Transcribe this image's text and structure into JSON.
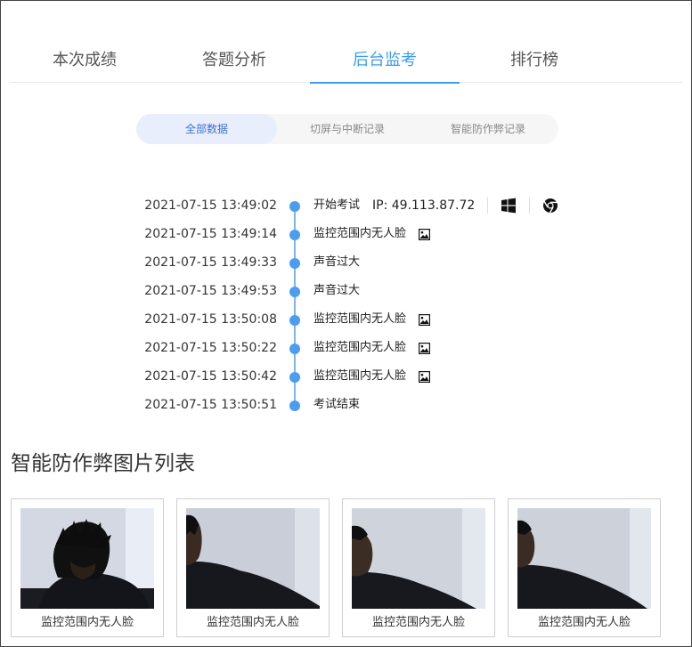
{
  "tabs": [
    {
      "label": "本次成绩",
      "active": false
    },
    {
      "label": "答题分析",
      "active": false
    },
    {
      "label": "后台监考",
      "active": true
    },
    {
      "label": "排行榜",
      "active": false
    }
  ],
  "filters": [
    {
      "label": "全部数据",
      "active": true
    },
    {
      "label": "切屏与中断记录",
      "active": false
    },
    {
      "label": "智能防作弊记录",
      "active": false
    }
  ],
  "timeline": [
    {
      "time": "2021-07-15 13:49:02",
      "event": "开始考试",
      "ip": "IP: 49.113.87.72",
      "os_icon": "windows-icon",
      "browser_icon": "chrome-icon",
      "has_image": false
    },
    {
      "time": "2021-07-15 13:49:14",
      "event": "监控范围内无人脸",
      "has_image": true
    },
    {
      "time": "2021-07-15 13:49:33",
      "event": "声音过大",
      "has_image": false
    },
    {
      "time": "2021-07-15 13:49:53",
      "event": "声音过大",
      "has_image": false
    },
    {
      "time": "2021-07-15 13:50:08",
      "event": "监控范围内无人脸",
      "has_image": true
    },
    {
      "time": "2021-07-15 13:50:22",
      "event": "监控范围内无人脸",
      "has_image": true
    },
    {
      "time": "2021-07-15 13:50:42",
      "event": "监控范围内无人脸",
      "has_image": true
    },
    {
      "time": "2021-07-15 13:50:51",
      "event": "考试结束",
      "has_image": false
    }
  ],
  "gallery": {
    "title": "智能防作弊图片列表",
    "items": [
      {
        "caption": "监控范围内无人脸"
      },
      {
        "caption": "监控范围内无人脸"
      },
      {
        "caption": "监控范围内无人脸"
      },
      {
        "caption": "监控范围内无人脸"
      }
    ]
  },
  "colors": {
    "accent": "#3b9cf0",
    "dot": "#4b9df0",
    "filter_active_bg": "#e9eefc"
  }
}
